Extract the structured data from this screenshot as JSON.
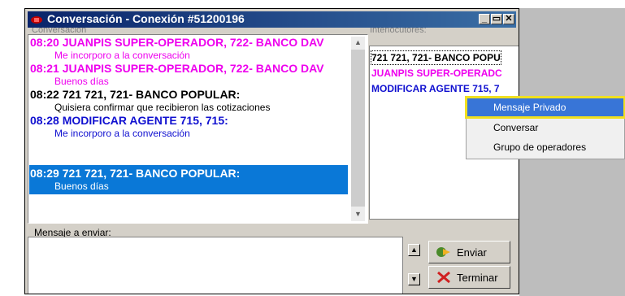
{
  "window": {
    "title": "Conversación - Conexión #51200196"
  },
  "titlebar_buttons": {
    "minimize": "_",
    "restore": "▭",
    "close": "✕"
  },
  "labels": {
    "conversation_ghost": "Conversación",
    "participants_ghost": "Interlocutores:",
    "message_label": "Mensaje a enviar:"
  },
  "conversation": [
    {
      "time": "08:20",
      "sender": "JUANPIS SUPER-OPERADOR, 722- BANCO DAV",
      "text": "Me incorporo a la conversación",
      "color": "#ee00ee"
    },
    {
      "time": "08:21",
      "sender": "JUANPIS SUPER-OPERADOR, 722- BANCO DAV",
      "text": "Buenos días",
      "color": "#ee00ee"
    },
    {
      "time": "08:22",
      "sender": "721 721, 721- BANCO POPULAR:",
      "text": "Quisiera confirmar que recibieron las cotizaciones",
      "color": "#000000"
    },
    {
      "time": "08:28",
      "sender": "MODIFICAR AGENTE 715, 715:",
      "text": "Me incorporo a la conversación",
      "color": "#1010d0"
    },
    {
      "time": "08:29",
      "sender": "721 721, 721- BANCO POPULAR:",
      "text": "Buenos días",
      "color": "#ffffff"
    }
  ],
  "participants": [
    {
      "name": "721 721, 721- BANCO POPU",
      "color": "#000000"
    },
    {
      "name": "JUANPIS SUPER-OPERADC",
      "color": "#ee00ee"
    },
    {
      "name": "MODIFICAR AGENTE 715, 7",
      "color": "#1010d0"
    }
  ],
  "buttons": {
    "send": "Enviar",
    "end": "Terminar"
  },
  "context_menu": [
    "Mensaje Privado",
    "Conversar",
    "Grupo de operadores"
  ],
  "colors": {
    "selection": "#0a78d7",
    "menu_highlight": "#3875d7",
    "highlight_outline": "#f0e020"
  }
}
